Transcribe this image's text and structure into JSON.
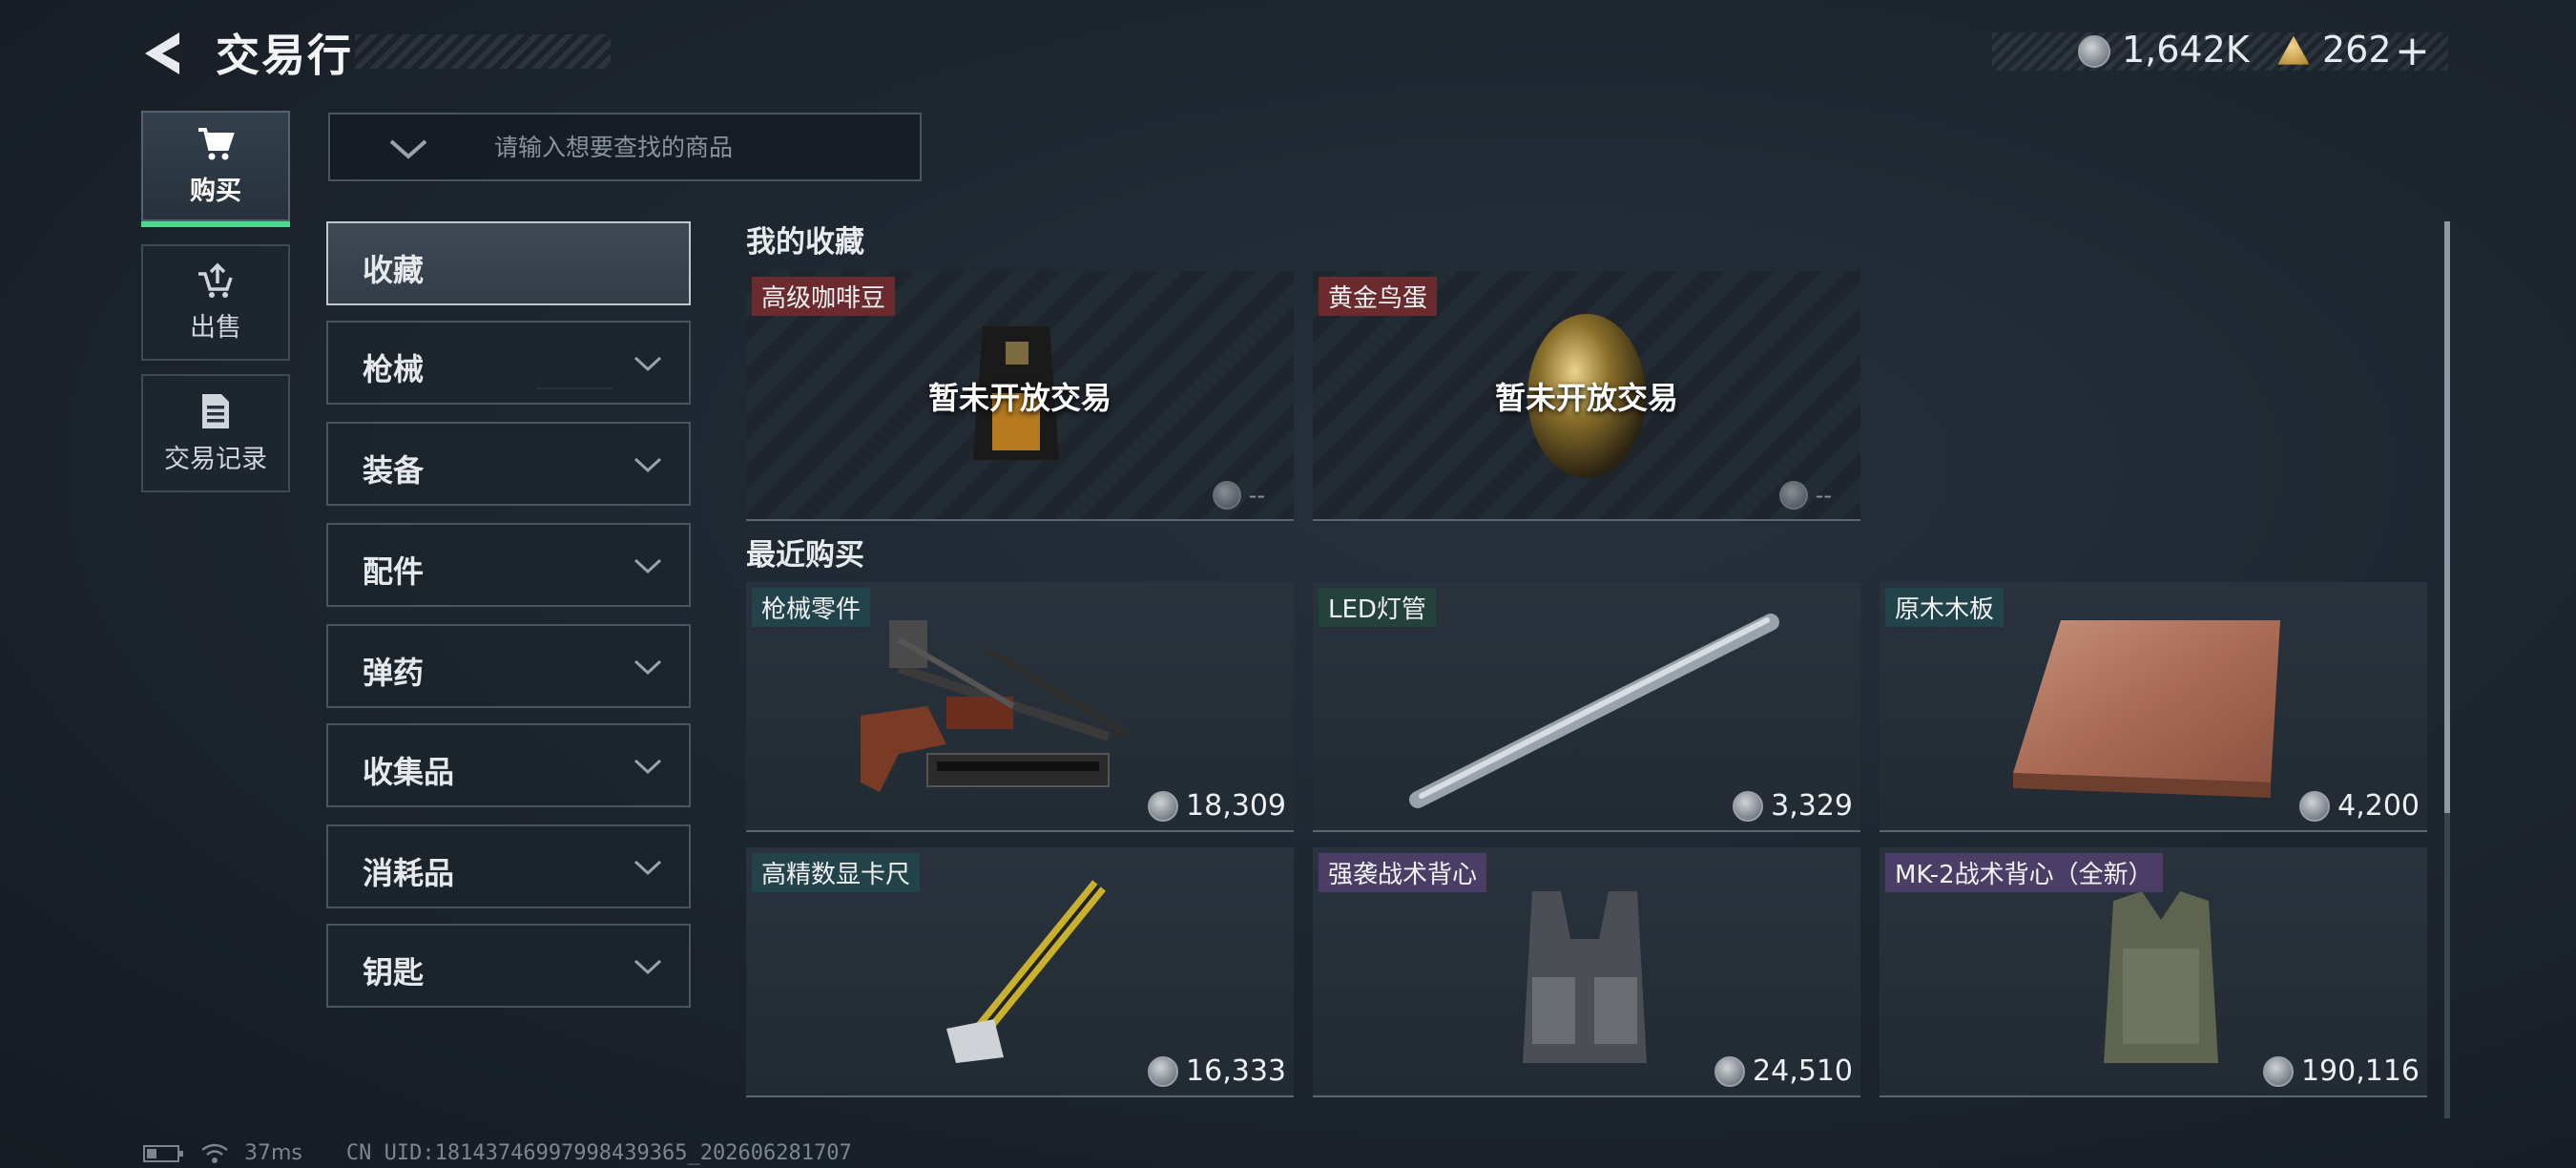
{
  "header": {
    "back_icon": "back-arrow-icon",
    "title": "交易行"
  },
  "currency": {
    "silver_icon": "silver-coin-icon",
    "silver_value": "1,642K",
    "gold_icon": "gold-triangle-coin-icon",
    "gold_value": "262",
    "plus": "+"
  },
  "nav": {
    "buy": {
      "label": "购买",
      "icon": "cart-icon"
    },
    "sell": {
      "label": "出售",
      "icon": "sell-cart-icon"
    },
    "records": {
      "label": "交易记录",
      "icon": "document-icon"
    }
  },
  "search": {
    "placeholder": "请输入想要查找的商品",
    "dropdown_icon": "chevron-down-icon"
  },
  "categories": [
    "收藏",
    "枪械",
    "装备",
    "配件",
    "弹药",
    "收集品",
    "消耗品",
    "钥匙"
  ],
  "favorites": {
    "title": "我的收藏",
    "items": [
      {
        "name": "高级咖啡豆",
        "status": "暂未开放交易",
        "price": "--"
      },
      {
        "name": "黄金鸟蛋",
        "status": "暂未开放交易",
        "price": "--"
      }
    ]
  },
  "recent": {
    "title": "最近购买",
    "items": [
      {
        "name": "枪械零件",
        "price": "18,309"
      },
      {
        "name": "LED灯管",
        "price": "3,329"
      },
      {
        "name": "原木木板",
        "price": "4,200"
      },
      {
        "name": "高精数显卡尺",
        "price": "16,333"
      },
      {
        "name": "强袭战术背心",
        "price": "24,510"
      },
      {
        "name": "MK-2战术背心（全新）",
        "price": "190,116"
      }
    ]
  },
  "footer": {
    "latency": "37ms",
    "uid": "CN UID:18143746997998439365_202606281707"
  },
  "colors": {
    "accent_green": "#4fd68f",
    "tag_red": "#6b2a2d",
    "tag_teal": "#23434a",
    "tag_purple": "#4a3e66"
  }
}
